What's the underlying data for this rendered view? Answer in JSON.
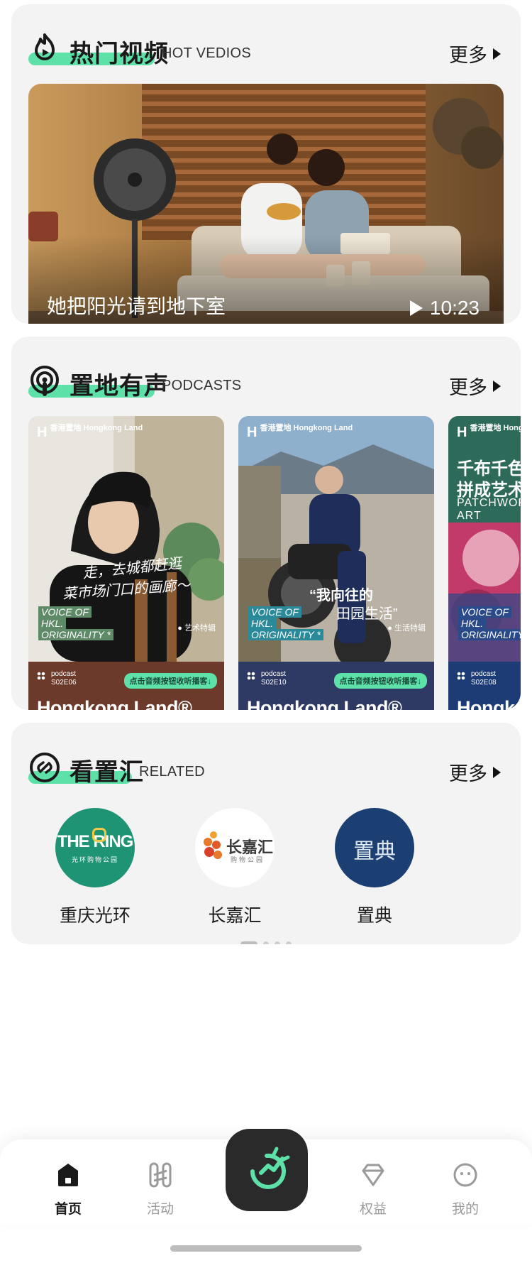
{
  "hot_videos": {
    "title": "热门视频",
    "subtitle": "HOT VEDIOS",
    "more": "更多",
    "video": {
      "caption": "她把阳光请到地下室",
      "duration": "10:23"
    }
  },
  "podcasts": {
    "title": "置地有声",
    "subtitle": "PODCASTS",
    "more": "更多",
    "items": [
      {
        "logo": "香港置地 Hongkong Land",
        "quote1": "走，去城都赶逛",
        "quote2": "菜市场门口的画廊～",
        "tag": "● 艺术特辑",
        "voice": [
          "VOICE OF",
          "HKL.",
          "ORIGINALITY *"
        ],
        "code": "podcast S02E06",
        "listen": "点击音频按钮收听播客↓",
        "brand": "Hongkong Land®",
        "band_color": "#6b3a2a"
      },
      {
        "logo": "香港置地 Hongkong Land",
        "quote1": "“我向往的",
        "quote2": "田园生活”",
        "tag": "● 生活特辑",
        "voice": [
          "VOICE OF",
          "HKL.",
          "ORIGINALITY *"
        ],
        "code": "podcast S02E10",
        "listen": "点击音频按钮收听播客↓",
        "brand": "Hongkong Land®",
        "band_color": "#2e3a63"
      },
      {
        "logo": "香港置地 Hongkong Land",
        "quote1": "千布千色",
        "quote2": "拼成艺术",
        "quote3": "PATCHWORK ART",
        "tag": "",
        "voice": [
          "VOICE OF",
          "HKL.",
          "ORIGINALITY *"
        ],
        "code": "podcast S02E08",
        "listen": "",
        "brand": "Hongkong Land®",
        "band_color": "#1d3b74"
      }
    ]
  },
  "related": {
    "title": "看置汇",
    "subtitle": "RELATED",
    "more": "更多",
    "items": [
      {
        "name": "重庆光环",
        "logo_text": "THE RING",
        "logo_sub": "光环购物公园"
      },
      {
        "name": "长嘉汇",
        "logo_text": "长嘉汇",
        "logo_sub": "购物公园"
      },
      {
        "name": "置典",
        "logo_text": "置典"
      }
    ]
  },
  "nav": {
    "items": [
      {
        "label": "首页",
        "icon": "home-icon",
        "active": true
      },
      {
        "label": "活动",
        "icon": "activity-icon"
      },
      {
        "label": "权益",
        "icon": "diamond-icon"
      },
      {
        "label": "我的",
        "icon": "profile-icon"
      }
    ],
    "center_icon": "compass-icon"
  },
  "colors": {
    "accent": "#5de1a9",
    "card_bg": "#f3f3f3",
    "nav_center": "#2a2a2a"
  }
}
